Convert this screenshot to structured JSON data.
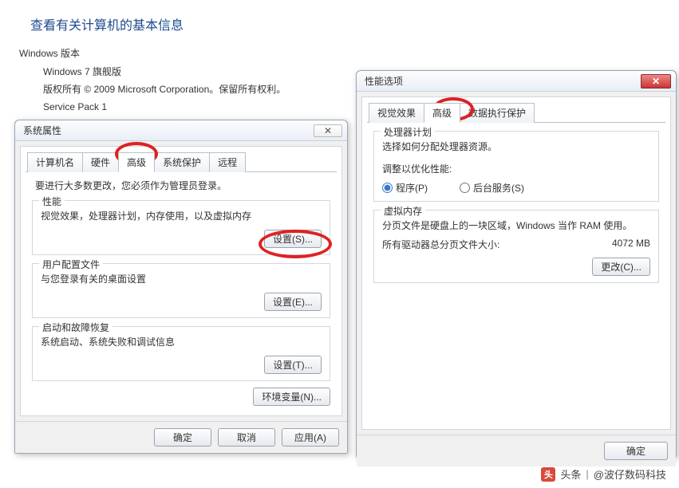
{
  "page": {
    "header": "查看有关计算机的基本信息",
    "windows_section": "Windows 版本",
    "win_edition": "Windows 7 旗舰版",
    "copyright": "版权所有 © 2009 Microsoft Corporation。保留所有权利。",
    "service_pack": "Service Pack 1"
  },
  "sysprop": {
    "title": "系统属性",
    "tabs": {
      "computer": "计算机名",
      "hardware": "硬件",
      "advanced": "高级",
      "protection": "系统保护",
      "remote": "远程"
    },
    "admin_note": "要进行大多数更改，您必须作为管理员登录。",
    "perf": {
      "legend": "性能",
      "desc": "视觉效果，处理器计划，内存使用，以及虚拟内存",
      "btn": "设置(S)..."
    },
    "profile": {
      "legend": "用户配置文件",
      "desc": "与您登录有关的桌面设置",
      "btn": "设置(E)..."
    },
    "startup": {
      "legend": "启动和故障恢复",
      "desc": "系统启动、系统失败和调试信息",
      "btn": "设置(T)..."
    },
    "env_btn": "环境变量(N)...",
    "ok": "确定",
    "cancel": "取消",
    "apply": "应用(A)"
  },
  "perfopt": {
    "title": "性能选项",
    "tabs": {
      "visual": "视觉效果",
      "advanced": "高级",
      "dep": "数据执行保护"
    },
    "sched": {
      "legend": "处理器计划",
      "desc": "选择如何分配处理器资源。",
      "adjust_label": "调整以优化性能:",
      "programs": "程序(P)",
      "services": "后台服务(S)"
    },
    "vm": {
      "legend": "虚拟内存",
      "desc": "分页文件是硬盘上的一块区域，Windows 当作 RAM 使用。",
      "total_label": "所有驱动器总分页文件大小:",
      "total_value": "4072 MB",
      "change_btn": "更改(C)..."
    },
    "ok": "确定"
  },
  "watermark": {
    "badge": "头",
    "label": "头条",
    "author": "@波仔数码科技"
  }
}
